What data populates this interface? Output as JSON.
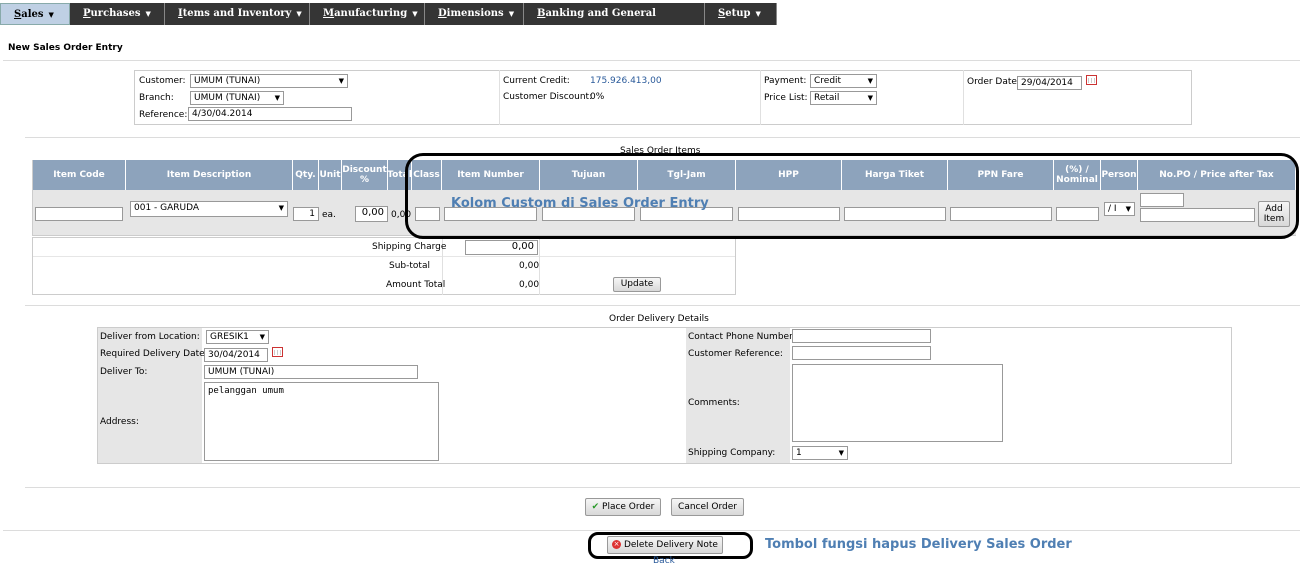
{
  "menu": [
    {
      "key": "S",
      "rest": "ales",
      "active": true
    },
    {
      "key": "P",
      "rest": "urchases"
    },
    {
      "key": "I",
      "rest": "tems and Inventory"
    },
    {
      "key": "M",
      "rest": "anufacturing"
    },
    {
      "key": "D",
      "rest": "imensions"
    },
    {
      "key": "B",
      "rest": "anking and General Ledger"
    },
    {
      "key": "S",
      "rest": "etup"
    }
  ],
  "page_title": "New Sales Order Entry",
  "header": {
    "customer_label": "Customer:",
    "customer_value": "UMUM (TUNAI)",
    "branch_label": "Branch:",
    "branch_value": "UMUM (TUNAI)",
    "reference_label": "Reference:",
    "reference_value": "4/30/04.2014",
    "current_credit_label": "Current Credit:",
    "current_credit_value": "175.926.413,00",
    "customer_discount_label": "Customer Discount:",
    "customer_discount_value": "0%",
    "payment_label": "Payment:",
    "payment_value": "Credit",
    "price_list_label": "Price List:",
    "price_list_value": "Retail",
    "order_date_label": "Order Date:",
    "order_date_value": "29/04/2014"
  },
  "items_section_title": "Sales Order Items",
  "columns": [
    "Item Code",
    "Item Description",
    "Qty.",
    "Unit",
    "Discount %",
    "Total",
    "Class",
    "Item Number",
    "Tujuan",
    "Tgl-Jam",
    "HPP",
    "Harga Tiket",
    "PPN Fare",
    "(%) / Nominal",
    "Person",
    "No.PO / Price after Tax"
  ],
  "row": {
    "item_description": "001 - GARUDA",
    "qty": "1",
    "unit": "ea.",
    "discount": "0,00",
    "total": "0,00",
    "person": "/ I",
    "add_item": "Add Item"
  },
  "totals": {
    "shipping_label": "Shipping Charge",
    "shipping_value": "0,00",
    "subtotal_label": "Sub-total",
    "subtotal_value": "0,00",
    "amount_label": "Amount Total",
    "amount_value": "0,00",
    "update_button": "Update"
  },
  "annotation_custom": "Kolom Custom di Sales Order Entry",
  "delivery": {
    "title": "Order Delivery Details",
    "from_location_label": "Deliver from Location:",
    "from_location_value": "GRESIK1",
    "required_date_label": "Required Delivery Date:",
    "required_date_value": "30/04/2014",
    "deliver_to_label": "Deliver To:",
    "deliver_to_value": "UMUM (TUNAI)",
    "address_label": "Address:",
    "address_value": "pelanggan umum",
    "contact_phone_label": "Contact Phone Number:",
    "customer_ref_label": "Customer Reference:",
    "comments_label": "Comments:",
    "shipping_company_label": "Shipping Company:",
    "shipping_company_value": "1"
  },
  "actions": {
    "place_order": "Place Order",
    "cancel_order": "Cancel Order",
    "delete_delivery_note": "Delete Delivery Note",
    "back": "Back"
  },
  "annotation_delete": "Tombol fungsi hapus Delivery Sales Order",
  "colors": {
    "menu_bg": "#353535",
    "table_header": "#8da3bc",
    "annotation": "#4f7fb3"
  }
}
